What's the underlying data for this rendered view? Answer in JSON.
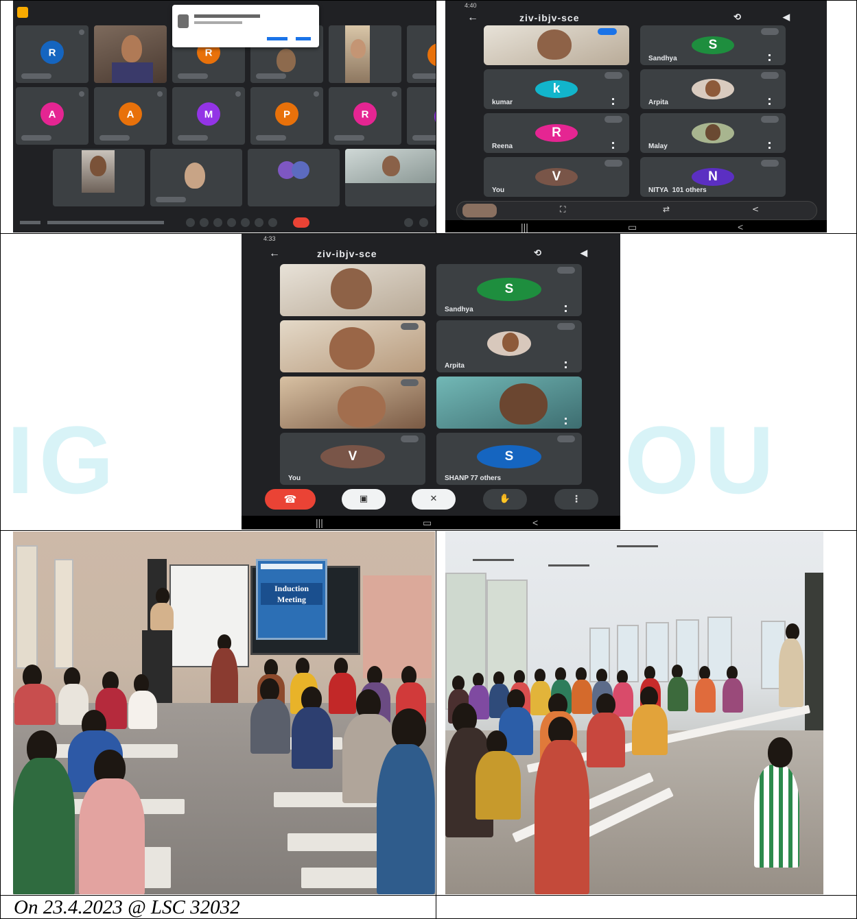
{
  "caption": "On 23.4.2023 @ LSC 32032",
  "phone_top": {
    "status_time": "4:40",
    "meeting_code": "ziv-ibjv-sce",
    "participants": [
      {
        "name": "",
        "type": "video"
      },
      {
        "name": "Sandhya",
        "initial": "S",
        "color": "#1e8e3e"
      },
      {
        "name": "kumar",
        "initial": "k",
        "color": "#12b5cb"
      },
      {
        "name": "Arpita",
        "type": "photo"
      },
      {
        "name": "Reena",
        "initial": "R",
        "color": "#e52592"
      },
      {
        "name": "Malay",
        "type": "photo"
      },
      {
        "name": "You",
        "initial": "V",
        "color": "#795548"
      },
      {
        "name": "NITYA",
        "initial": "N",
        "color": "#5b2fc2"
      }
    ],
    "others": "101 others"
  },
  "phone_mid": {
    "status_time": "4:33",
    "meeting_code": "ziv-ibjv-sce",
    "participants": [
      {
        "name": "",
        "type": "video"
      },
      {
        "name": "Sandhya",
        "initial": "S",
        "color": "#1e8e3e"
      },
      {
        "name": "",
        "type": "video"
      },
      {
        "name": "Arpita",
        "type": "photo"
      },
      {
        "name": "",
        "type": "video"
      },
      {
        "name": "",
        "type": "video"
      },
      {
        "name": "You",
        "initial": "V",
        "color": "#795548"
      },
      {
        "name": "SHANP",
        "initial": "S",
        "color": "#1565c0"
      }
    ],
    "others": "77 others"
  },
  "desktop": {
    "tiles": [
      {
        "initial": "R",
        "color": "#1565c0"
      },
      {
        "initial": "R",
        "color": "#e8710a"
      },
      {
        "initial": "A",
        "color": "#e52592"
      },
      {
        "initial": "A",
        "color": "#e8710a"
      },
      {
        "initial": "M",
        "color": "#9334e6"
      },
      {
        "initial": "P",
        "color": "#e8710a"
      },
      {
        "initial": "R",
        "color": "#e52592"
      }
    ]
  },
  "banner_text": "Induction Meeting"
}
